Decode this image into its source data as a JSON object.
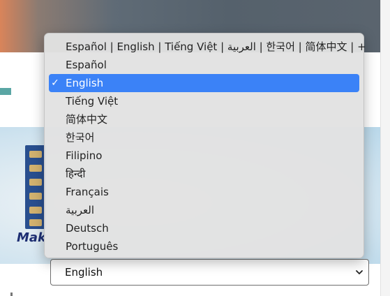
{
  "select": {
    "value": "English",
    "options": [
      "Español | English | Tiếng Việt | العربية | 한국어 | 简体中文 | +",
      "Español",
      "English",
      "Tiếng Việt",
      "简体中文",
      "한국어",
      "Filipino",
      "हिन्दी",
      "Français",
      "العربية",
      "Deutsch",
      "Português"
    ],
    "selected_index": 2,
    "check_glyph": "✓"
  },
  "banner": {
    "logo_text": "Mak"
  },
  "icons": {
    "checkmark": "checkmark-icon",
    "select_chevron": "chevron-down-icon"
  },
  "colors": {
    "selected_highlight": "#3b82f7",
    "menu_background": "#e2e2e2",
    "teal_accent": "#5aa6a4",
    "banner_logo": "#1e2f73"
  }
}
